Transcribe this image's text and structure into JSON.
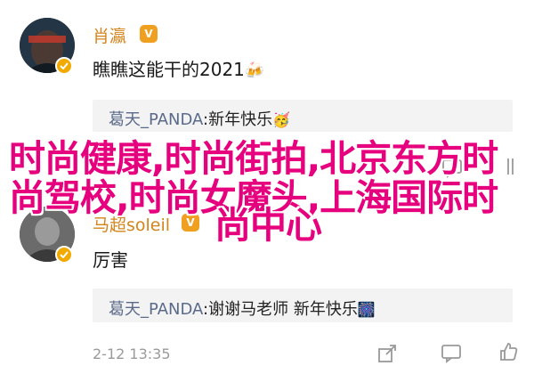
{
  "comment1": {
    "username": "肖瀛",
    "text": "瞧瞧这能干的2021",
    "emoji": "🍻"
  },
  "reply1": {
    "author": "葛天_PANDA",
    "separator": ":",
    "text": "新年快乐",
    "emoji": "🥳"
  },
  "comment2": {
    "username": "马超soleil",
    "text": "厉害"
  },
  "reply2": {
    "author": "葛天_PANDA",
    "separator": ":",
    "text": "谢谢马老师 新年快乐",
    "emoji": "🎆"
  },
  "comment2_meta": {
    "timestamp": "2-12 13:35"
  },
  "overlay": {
    "line1": "时尚健康,时尚街拍,北京东方时",
    "line2": "尚驾校,时尚女魔头,上海国际时",
    "line3": "尚中心"
  },
  "colors": {
    "username": "#d4841b",
    "reply_author": "#5b6a8a",
    "overlay_text": "#e6007e",
    "verified_badge": "#f2a900"
  },
  "icons": [
    "verified-icon",
    "vip-badge-icon",
    "share-icon",
    "comment-icon",
    "like-icon"
  ]
}
